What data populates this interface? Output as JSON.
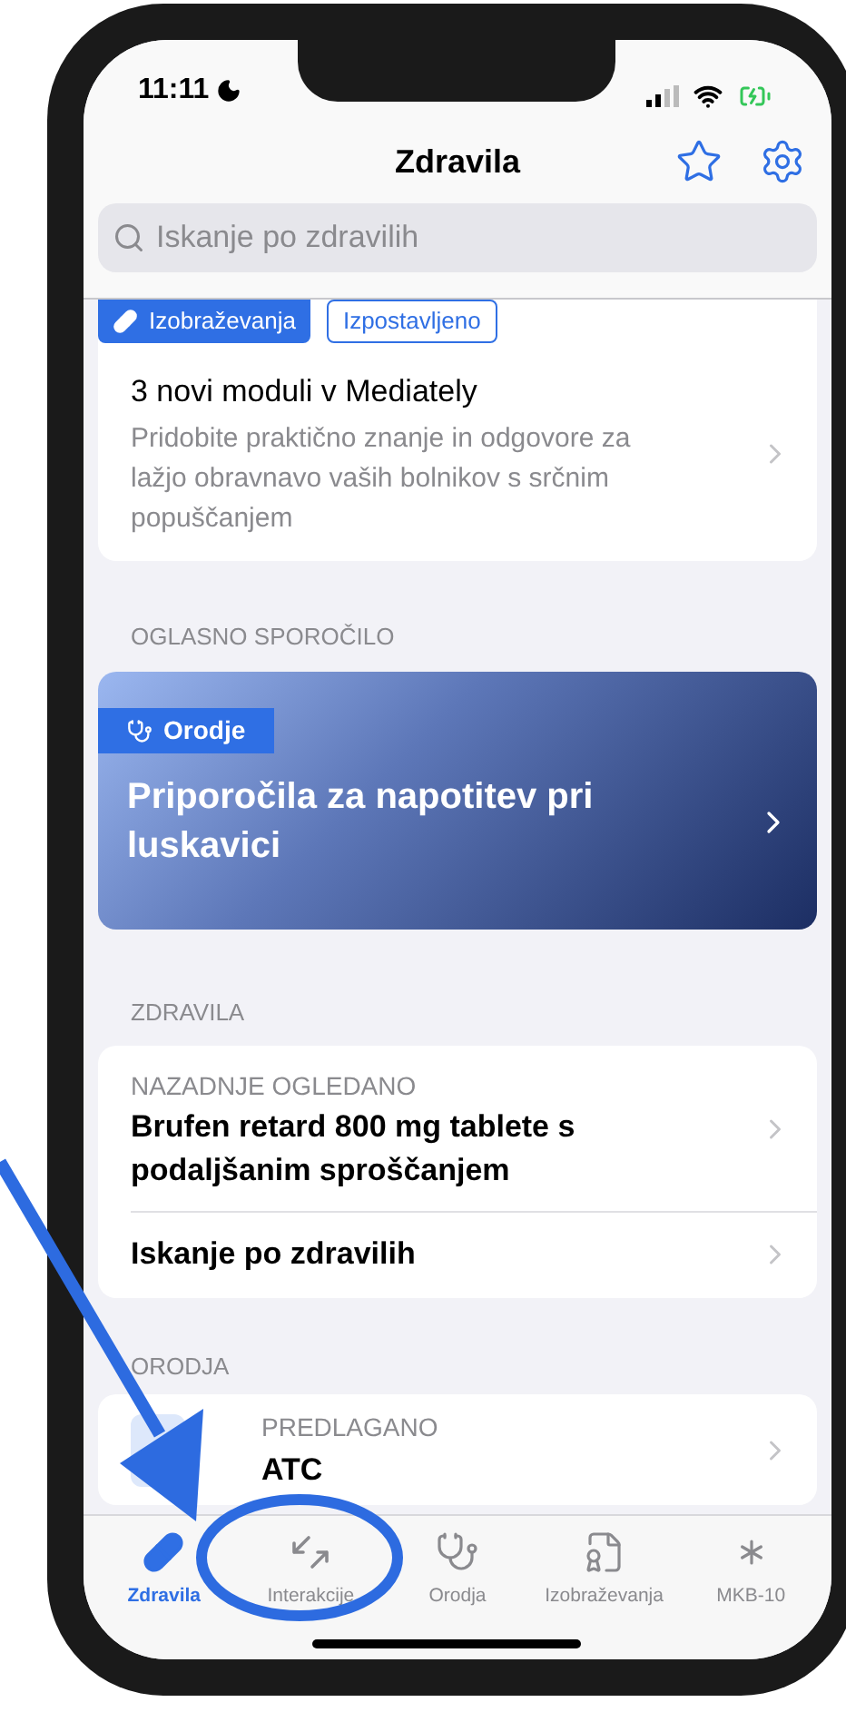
{
  "status_bar": {
    "time": "11:11"
  },
  "nav": {
    "title": "Zdravila"
  },
  "search": {
    "placeholder": "Iskanje po zdravilih"
  },
  "feature_card": {
    "tags": [
      {
        "label": "Izobraževanja",
        "kind": "filled"
      },
      {
        "label": "Izpostavljeno",
        "kind": "outline"
      }
    ],
    "title": "3 novi moduli v Mediately",
    "description": "Pridobite praktično znanje in odgovore za lažjo obravnavo vaših bolnikov s srčnim popuščanjem"
  },
  "ad_section": {
    "label": "OGLASNO SPOROČILO",
    "banner": {
      "tag": "Orodje",
      "title": "Priporočila za napotitev pri luskavici"
    }
  },
  "drugs_section": {
    "label": "ZDRAVILA",
    "rows": [
      {
        "kind": "recent",
        "caption": "NAZADNJE OGLEDANO",
        "title": "Brufen retard 800 mg tablete s podaljšanim sproščanjem"
      },
      {
        "kind": "plain",
        "title": "Iskanje po zdravilih"
      }
    ]
  },
  "tools_section": {
    "label": "ORODJA",
    "rows": [
      {
        "caption": "PREDLAGANO",
        "title": "ATC"
      }
    ]
  },
  "tabs": [
    {
      "label": "Zdravila",
      "selected": true
    },
    {
      "label": "Interakcije",
      "selected": false
    },
    {
      "label": "Orodja",
      "selected": false
    },
    {
      "label": "Izobraževanja",
      "selected": false
    },
    {
      "label": "MKB-10",
      "selected": false
    }
  ]
}
